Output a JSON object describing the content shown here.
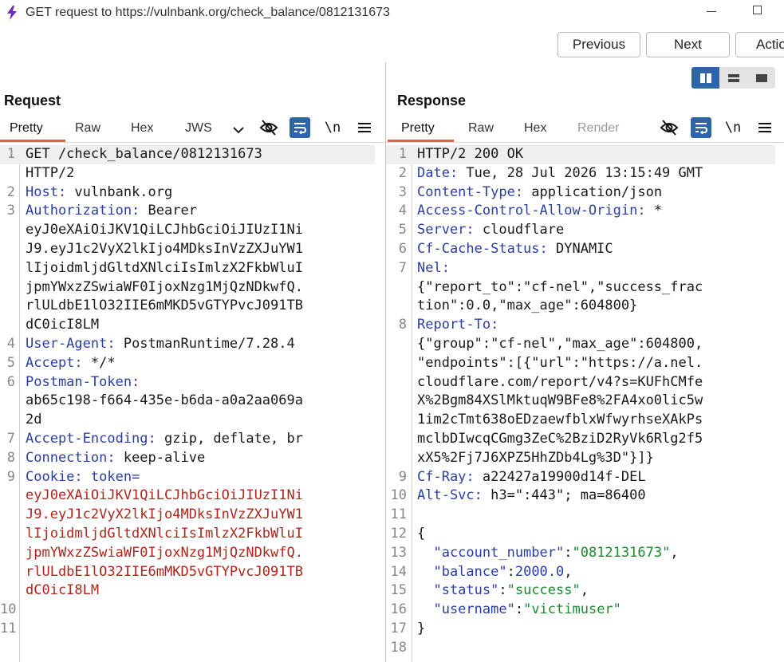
{
  "window": {
    "title": "GET request to https://vulnbank.org/check_balance/0812131673"
  },
  "toolbar": {
    "previous": "Previous",
    "next": "Next",
    "action": "Actio"
  },
  "request": {
    "heading": "Request",
    "tabs": [
      "Pretty",
      "Raw",
      "Hex",
      "JWS"
    ],
    "newline_label": "\\n",
    "lines": {
      "l1": "GET /check_balance/0812131673",
      "l1b": "HTTP/2",
      "host_k": "Host:",
      "host_v": " vulnbank.org",
      "auth_k": "Authorization:",
      "auth_v": " Bearer",
      "auth_t1": "eyJ0eXAiOiJKV1QiLCJhbGciOiJIUzI1Ni",
      "auth_t2": "J9.eyJ1c2VyX2lkIjo4MDksInVzZXJuYW1",
      "auth_t3": "lIjoidmljdGltdXNlciIsImlzX2FkbWluI",
      "auth_t4": "jpmYWxzZSwiaWF0IjoxNzg1MjQzNDkwfQ.",
      "auth_t5": "rlULdbE1lO32IIE6mMKD5vGTYPvcJ091TB",
      "auth_t6": "dC0icI8LM",
      "ua_k": "User-Agent:",
      "ua_v": " PostmanRuntime/7.28.4",
      "acc_k": "Accept:",
      "acc_v": " */*",
      "pt_k": "Postman-Token:",
      "pt_v1": "ab65c198-f664-435e-b6da-a0a2aa069a",
      "pt_v2": "2d",
      "ae_k": "Accept-Encoding:",
      "ae_v": " gzip, deflate, br",
      "con_k": "Connection:",
      "con_v": " keep-alive",
      "ck_k": "Cookie:",
      "ck_name": " token=",
      "ck_t1": "eyJ0eXAiOiJKV1QiLCJhbGciOiJIUzI1Ni",
      "ck_t2": "J9.eyJ1c2VyX2lkIjo4MDksInVzZXJuYW1",
      "ck_t3": "lIjoidmljdGltdXNlciIsImlzX2FkbWluI",
      "ck_t4": "jpmYWxzZSwiaWF0IjoxNzg1MjQzNDkwfQ.",
      "ck_t5": "rlULdbE1lO32IIE6mMKD5vGTYPvcJ091TB",
      "ck_t6": "dC0icI8LM"
    }
  },
  "response": {
    "heading": "Response",
    "tabs": [
      "Pretty",
      "Raw",
      "Hex",
      "Render"
    ],
    "newline_label": "\\n",
    "lines": {
      "status": "HTTP/2 200 OK",
      "date_k": "Date:",
      "date_v": " Tue, 28 Jul 2026 13:15:49 GMT",
      "ct_k": "Content-Type:",
      "ct_v": " application/json",
      "acao_k": "Access-Control-Allow-Origin:",
      "acao_v": " *",
      "srv_k": "Server:",
      "srv_v": " cloudflare",
      "cf_k": "Cf-Cache-Status:",
      "cf_v": " DYNAMIC",
      "nel_k": "Nel:",
      "nel_v1": "{\"report_to\":\"cf-nel\",\"success_frac",
      "nel_v2": "tion\":0.0,\"max_age\":604800}",
      "rt_k": "Report-To:",
      "rt_v1": "{\"group\":\"cf-nel\",\"max_age\":604800,",
      "rt_v2": "\"endpoints\":[{\"url\":\"https://a.nel.",
      "rt_v3": "cloudflare.com/report/v4?s=KUFhCMfe",
      "rt_v4": "X%2Bgm84XSlMktuqW9BFe8%2FA4xo0lic5w",
      "rt_v5": "1im2cTmt638oEDzaewfblxWfwyrhseXAkPs",
      "rt_v6": "mclbDIwcqCGmg3ZeC%2BziD2RyVk6Rlg2f5",
      "rt_v7": "xX5%2Fj7J6XPZ5HhZDb4Lg%3D\"}]}",
      "ray_k": "Cf-Ray:",
      "ray_v": " a22427a19900d14f-DEL",
      "alt_k": "Alt-Svc:",
      "alt_v": " h3=\":443\"; ma=86400",
      "brace_open": "{",
      "an_k": "  \"account_number\"",
      "an_sep": ":",
      "an_v": "\"0812131673\"",
      "an_c": ",",
      "bal_k": "  \"balance\"",
      "bal_sep": ":",
      "bal_v": "2000.0",
      "bal_c": ",",
      "st_k": "  \"status\"",
      "st_sep": ":",
      "st_v": "\"success\"",
      "st_c": ",",
      "un_k": "  \"username\"",
      "un_sep": ":",
      "un_v": "\"victimuser\"",
      "brace_close": "}"
    }
  },
  "line_numbers": {
    "req": [
      "1",
      "2",
      "3",
      "4",
      "5",
      "6",
      "7",
      "8",
      "9",
      "10",
      "11"
    ],
    "res": [
      "1",
      "2",
      "3",
      "4",
      "5",
      "6",
      "7",
      "8",
      "9",
      "10",
      "11",
      "12",
      "13",
      "14",
      "15",
      "16",
      "17",
      "18"
    ]
  },
  "colors": {
    "accent_tab": "#e8622c",
    "accent_blue": "#2e64a8",
    "header_key": "#2a3fa6",
    "token_red": "#b0251b",
    "json_string": "#1d8a2f"
  }
}
